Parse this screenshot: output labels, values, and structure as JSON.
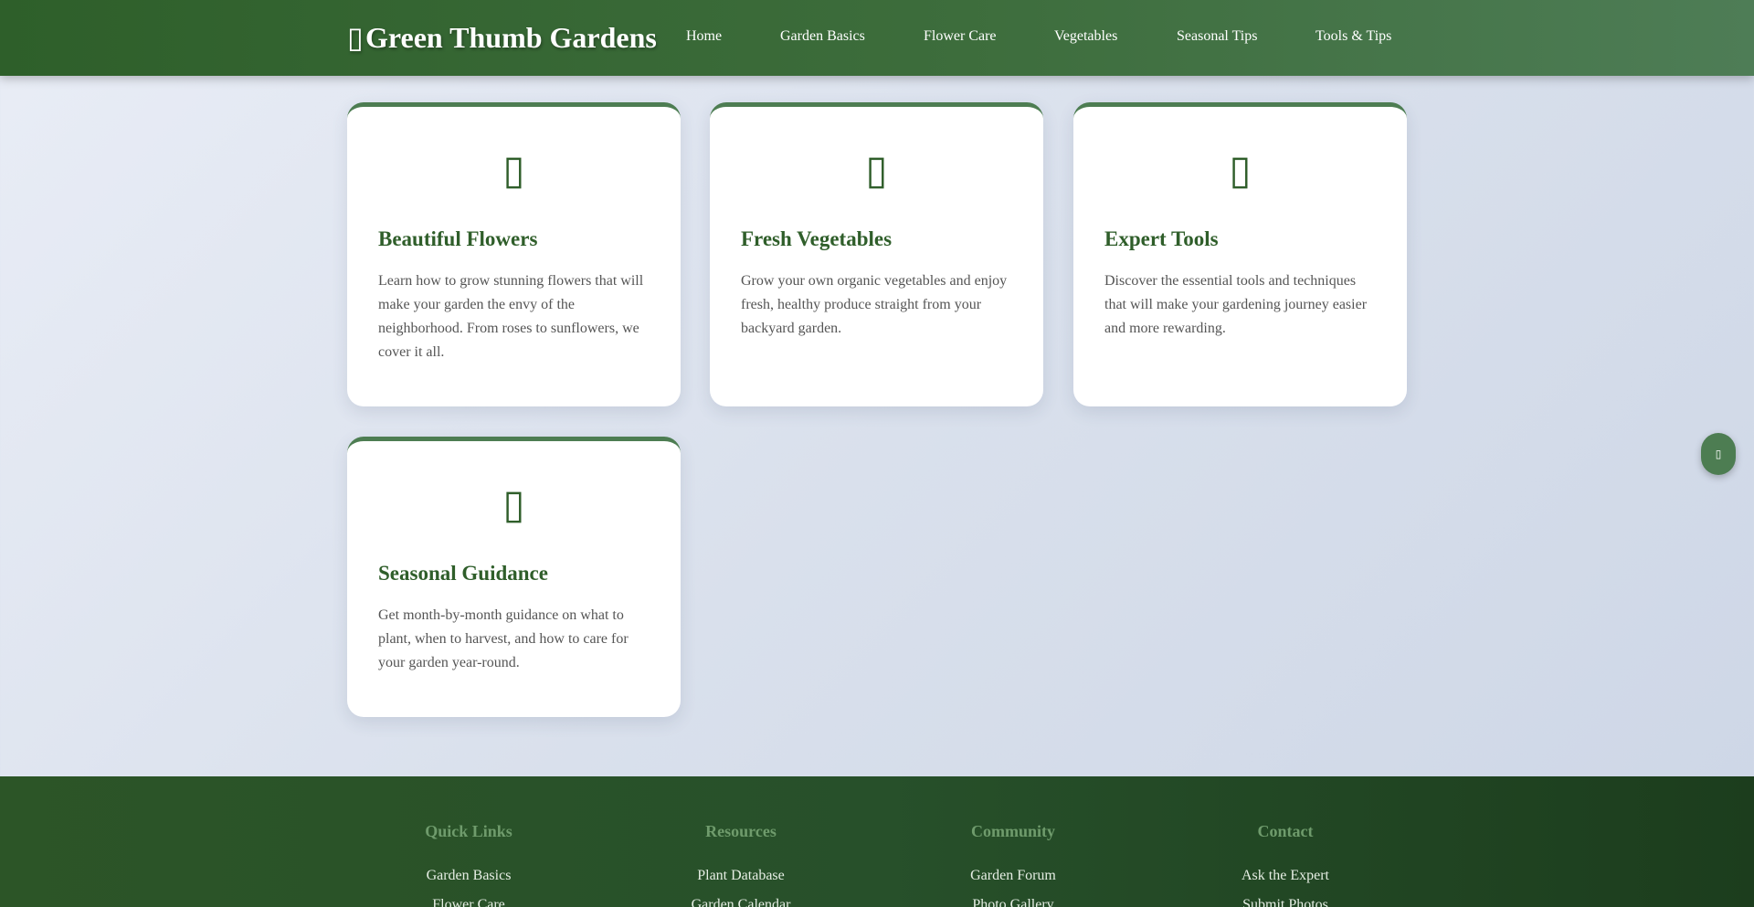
{
  "header": {
    "logo_icon": "plant-icon",
    "logo_text": "Green Thumb Gardens",
    "nav": [
      "Home",
      "Garden Basics",
      "Flower Care",
      "Vegetables",
      "Seasonal Tips",
      "Tools & Tips"
    ]
  },
  "cards": [
    {
      "icon": "flower-icon",
      "title": "Beautiful Flowers",
      "text": "Learn how to grow stunning flowers that will make your garden the envy of the neighborhood. From roses to sunflowers, we cover it all."
    },
    {
      "icon": "vegetable-icon",
      "title": "Fresh Vegetables",
      "text": "Grow your own organic vegetables and enjoy fresh, healthy produce straight from your backyard garden."
    },
    {
      "icon": "tools-icon",
      "title": "Expert Tools",
      "text": "Discover the essential tools and techniques that will make your gardening journey easier and more rewarding."
    },
    {
      "icon": "calendar-icon",
      "title": "Seasonal Guidance",
      "text": "Get month-by-month guidance on what to plant, when to harvest, and how to care for your garden year-round."
    }
  ],
  "float_button_icon": "scroll-up-icon",
  "footer": {
    "columns": [
      {
        "heading": "Quick Links",
        "links": [
          "Garden Basics",
          "Flower Care"
        ]
      },
      {
        "heading": "Resources",
        "links": [
          "Plant Database",
          "Garden Calendar"
        ]
      },
      {
        "heading": "Community",
        "links": [
          "Garden Forum",
          "Photo Gallery"
        ]
      },
      {
        "heading": "Contact",
        "links": [
          "Ask the Expert",
          "Submit Photos"
        ]
      }
    ]
  },
  "colors": {
    "header": "#3d6d3c",
    "accent_green": "#2f5e2a",
    "footer": "#27502a",
    "footer_heading": "#6f9b6c"
  }
}
